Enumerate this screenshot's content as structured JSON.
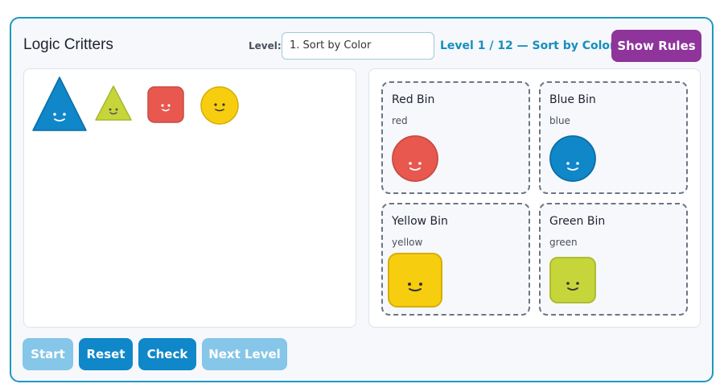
{
  "app": {
    "title": "Logic Critters"
  },
  "level": {
    "label": "Level:",
    "selected": "1. Sort by Color",
    "status": "Level 1 / 12 — Sort by Color"
  },
  "show_rules_label": "Show Rules",
  "bins": [
    {
      "name": "Red Bin",
      "rule": "red"
    },
    {
      "name": "Blue Bin",
      "rule": "blue"
    },
    {
      "name": "Yellow Bin",
      "rule": "yellow"
    },
    {
      "name": "Green Bin",
      "rule": "green"
    }
  ],
  "critters": {
    "pool": [
      {
        "shape": "triangle",
        "size": "large",
        "color": "blue"
      },
      {
        "shape": "triangle",
        "size": "small",
        "color": "green"
      },
      {
        "shape": "square",
        "size": "small",
        "color": "red"
      },
      {
        "shape": "circle",
        "size": "small",
        "color": "yellow"
      }
    ],
    "in_bins": [
      {
        "bin": "Red Bin",
        "shape": "circle",
        "color": "red"
      },
      {
        "bin": "Blue Bin",
        "shape": "circle",
        "color": "blue"
      },
      {
        "bin": "Yellow Bin",
        "shape": "square",
        "color": "yellow"
      },
      {
        "bin": "Green Bin",
        "shape": "square",
        "color": "green"
      }
    ]
  },
  "colors": {
    "red": "#e8584f",
    "blue": "#0f87c9",
    "yellow": "#f7cd10",
    "green": "#c6d63a",
    "accent": "#1e98c0",
    "rules_button": "#8e349a"
  },
  "controls": {
    "start": "Start",
    "reset": "Reset",
    "check": "Check",
    "next_level": "Next Level"
  }
}
